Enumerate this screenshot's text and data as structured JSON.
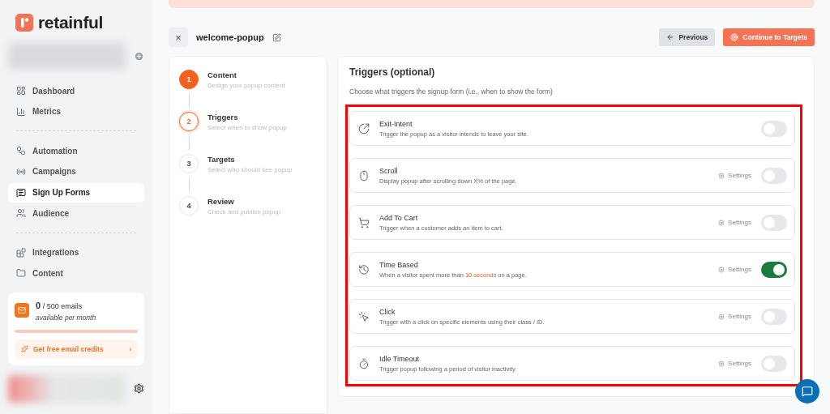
{
  "sidebar": {
    "logo": "retainful",
    "groups": [
      [
        {
          "label": "Dashboard",
          "selected": false
        },
        {
          "label": "Metrics",
          "selected": false
        }
      ],
      [
        {
          "label": "Automation",
          "selected": false
        },
        {
          "label": "Campaigns",
          "selected": false
        },
        {
          "label": "Sign Up Forms",
          "selected": true
        },
        {
          "label": "Audience",
          "selected": false
        }
      ],
      [
        {
          "label": "Integrations",
          "selected": false
        },
        {
          "label": "Content",
          "selected": false
        }
      ]
    ],
    "usage": {
      "count": "0",
      "total": "/ 500 emails",
      "note": "available per month",
      "link": "Get free email credits",
      "link_icon": "›"
    }
  },
  "header": {
    "close": "×",
    "title": "welcome-popup",
    "buttons": [
      {
        "label": "Previous",
        "kind": "secondary"
      },
      {
        "label": "Continue to Targets",
        "kind": "primary"
      }
    ]
  },
  "steps": [
    {
      "number": "1",
      "title": "Content",
      "subtitle": "Design your popup content",
      "completed": true,
      "selected": false
    },
    {
      "number": "2",
      "title": "Triggers",
      "subtitle": "Select when to show popup",
      "completed": false,
      "selected": true
    },
    {
      "number": "3",
      "title": "Targets",
      "subtitle": "Select who should see popup",
      "completed": false,
      "selected": false
    },
    {
      "number": "4",
      "title": "Review",
      "subtitle": "Check and publish popup",
      "completed": false,
      "selected": false
    }
  ],
  "triggers": {
    "title": "Triggers (optional)",
    "description": "Choose what triggers the signup form (i.e., when to show the form)",
    "items": [
      {
        "kind": "exit",
        "title": "Exit-Intent",
        "description": "Trigger the popup as a visitor intends to leave your site.",
        "on": false
      },
      {
        "kind": "scroll",
        "title": "Scroll",
        "description": "Display popup after scrolling down X% of the page.",
        "settings": "Settings",
        "on": false
      },
      {
        "kind": "cart",
        "title": "Add To Cart",
        "description": "Trigger when a customer adds an item to cart.",
        "settings": "Settings",
        "on": false
      },
      {
        "kind": "time",
        "title": "Time Based",
        "description": "When a visitor spent more than **10 seconds** on a page.",
        "settings": "Settings",
        "on": true
      },
      {
        "kind": "click",
        "title": "Click",
        "description": "Trigger with a click on specific elements using their class / ID.",
        "settings": "Settings",
        "on": false
      },
      {
        "kind": "idle",
        "title": "Idle Timeout",
        "description": "Trigger popup following a period of visitor inactivity.",
        "settings": "Settings",
        "on": false
      }
    ]
  }
}
